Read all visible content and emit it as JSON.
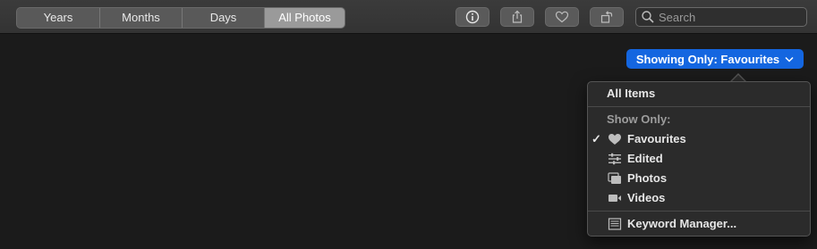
{
  "toolbar": {
    "segments": [
      "Years",
      "Months",
      "Days",
      "All Photos"
    ],
    "active_segment": "All Photos",
    "buttons": [
      "info-icon",
      "share-icon",
      "heart-icon",
      "rotate-icon"
    ],
    "search": {
      "placeholder": "Search",
      "value": ""
    }
  },
  "filter": {
    "button_label": "Showing Only: Favourites",
    "accent_color": "#1466e0"
  },
  "menu": {
    "all_items": "All Items",
    "show_only_header": "Show Only:",
    "options": [
      {
        "label": "Favourites",
        "icon": "heart-icon",
        "checked": true
      },
      {
        "label": "Edited",
        "icon": "sliders-icon",
        "checked": false
      },
      {
        "label": "Photos",
        "icon": "photos-icon",
        "checked": false
      },
      {
        "label": "Videos",
        "icon": "video-icon",
        "checked": false
      }
    ],
    "check_mark": "✓",
    "keyword_manager": "Keyword Manager..."
  }
}
